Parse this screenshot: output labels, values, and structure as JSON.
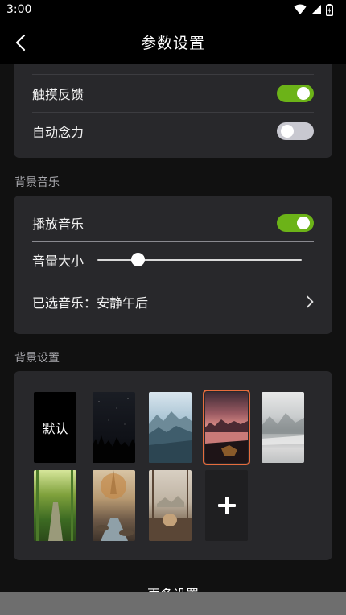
{
  "status": {
    "time": "3:00"
  },
  "header": {
    "title": "参数设置"
  },
  "settings": {
    "haptic_label": "触摸反馈",
    "haptic_on": true,
    "auto_mind_label": "自动念力",
    "auto_mind_on": false
  },
  "music": {
    "section_title": "背景音乐",
    "play_label": "播放音乐",
    "play_on": true,
    "volume_label": "音量大小",
    "volume_level": 0.2,
    "selected_label": "已选音乐：安静午后"
  },
  "background": {
    "section_title": "背景设置",
    "default_label": "默认",
    "selected_index": 3
  },
  "footer": {
    "more_label": "更多设置"
  },
  "colors": {
    "accent": "#6cb318",
    "card": "#28282b",
    "selected_outline": "#e76c3d"
  }
}
